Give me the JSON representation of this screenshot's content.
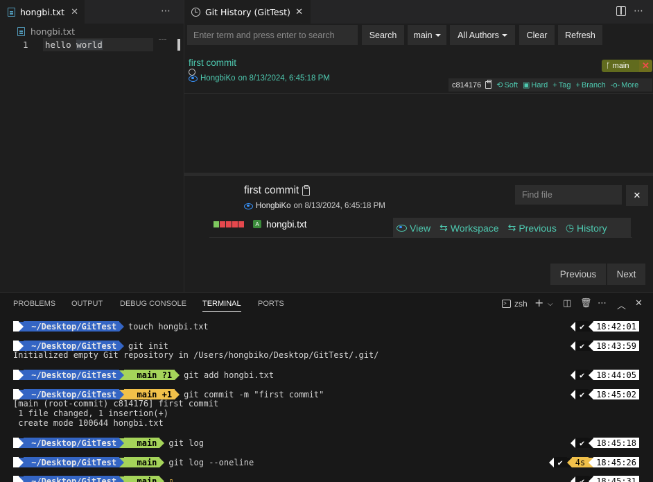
{
  "editor": {
    "tab_title": "hongbi.txt",
    "breadcrumb": "hongbi.txt",
    "line_number": "1",
    "code_word1": "hello",
    "code_word2": "world"
  },
  "git_history": {
    "tab_title": "Git History (GitTest)",
    "search_placeholder": "Enter term and press enter to search",
    "buttons": {
      "search": "Search",
      "branch": "main",
      "authors": "All Authors",
      "clear": "Clear",
      "refresh": "Refresh"
    },
    "commit": {
      "title": "first commit",
      "author": "HongbiKo",
      "date": "on 8/13/2024, 6:45:18 PM",
      "branch_badge": "main",
      "hash": "c814176",
      "actions": [
        "Soft",
        "Hard",
        "Tag",
        "Branch",
        "More"
      ]
    },
    "detail": {
      "title": "first commit",
      "author": "HongbiKo",
      "date": "on 8/13/2024, 6:45:18 PM",
      "find_placeholder": "Find file",
      "file_status": "A",
      "file_name": "hongbi.txt",
      "file_actions": [
        "View",
        "Workspace",
        "Previous",
        "History"
      ],
      "stat_colors": [
        "#7ec85f",
        "#e5484d",
        "#e5484d",
        "#e5484d",
        "#e5484d"
      ]
    },
    "pager": {
      "previous": "Previous",
      "next": "Next"
    }
  },
  "panel": {
    "tabs": [
      "PROBLEMS",
      "OUTPUT",
      "DEBUG CONSOLE",
      "TERMINAL",
      "PORTS"
    ],
    "active_tab": "TERMINAL",
    "terminal_name": "zsh"
  },
  "terminal": {
    "os_glyph": "",
    "dir": "~/Desktop/GitTest",
    "lines": [
      {
        "cmd": "touch hongbi.txt",
        "git": "",
        "time": "18:42:01"
      },
      {
        "cmd": "git init",
        "git": "",
        "time": "18:43:59",
        "output": "Initialized empty Git repository in /Users/hongbiko/Desktop/GitTest/.git/"
      },
      {
        "cmd": "git add hongbi.txt",
        "git": "  main ?1",
        "time": "18:44:05"
      },
      {
        "cmd": "git commit -m \"first commit\"",
        "git": "  main +1",
        "time": "18:45:02",
        "output": "[main (root-commit) c814176] first commit\n 1 file changed, 1 insertion(+)\n create mode 100644 hongbi.txt"
      },
      {
        "cmd": "git log",
        "git": "  main",
        "time": "18:45:18"
      },
      {
        "cmd": "git log --oneline",
        "git": "  main",
        "time": "18:45:26",
        "duration": "4s "
      },
      {
        "cmd": "",
        "git": "  main",
        "time": "18:45:31"
      }
    ]
  }
}
